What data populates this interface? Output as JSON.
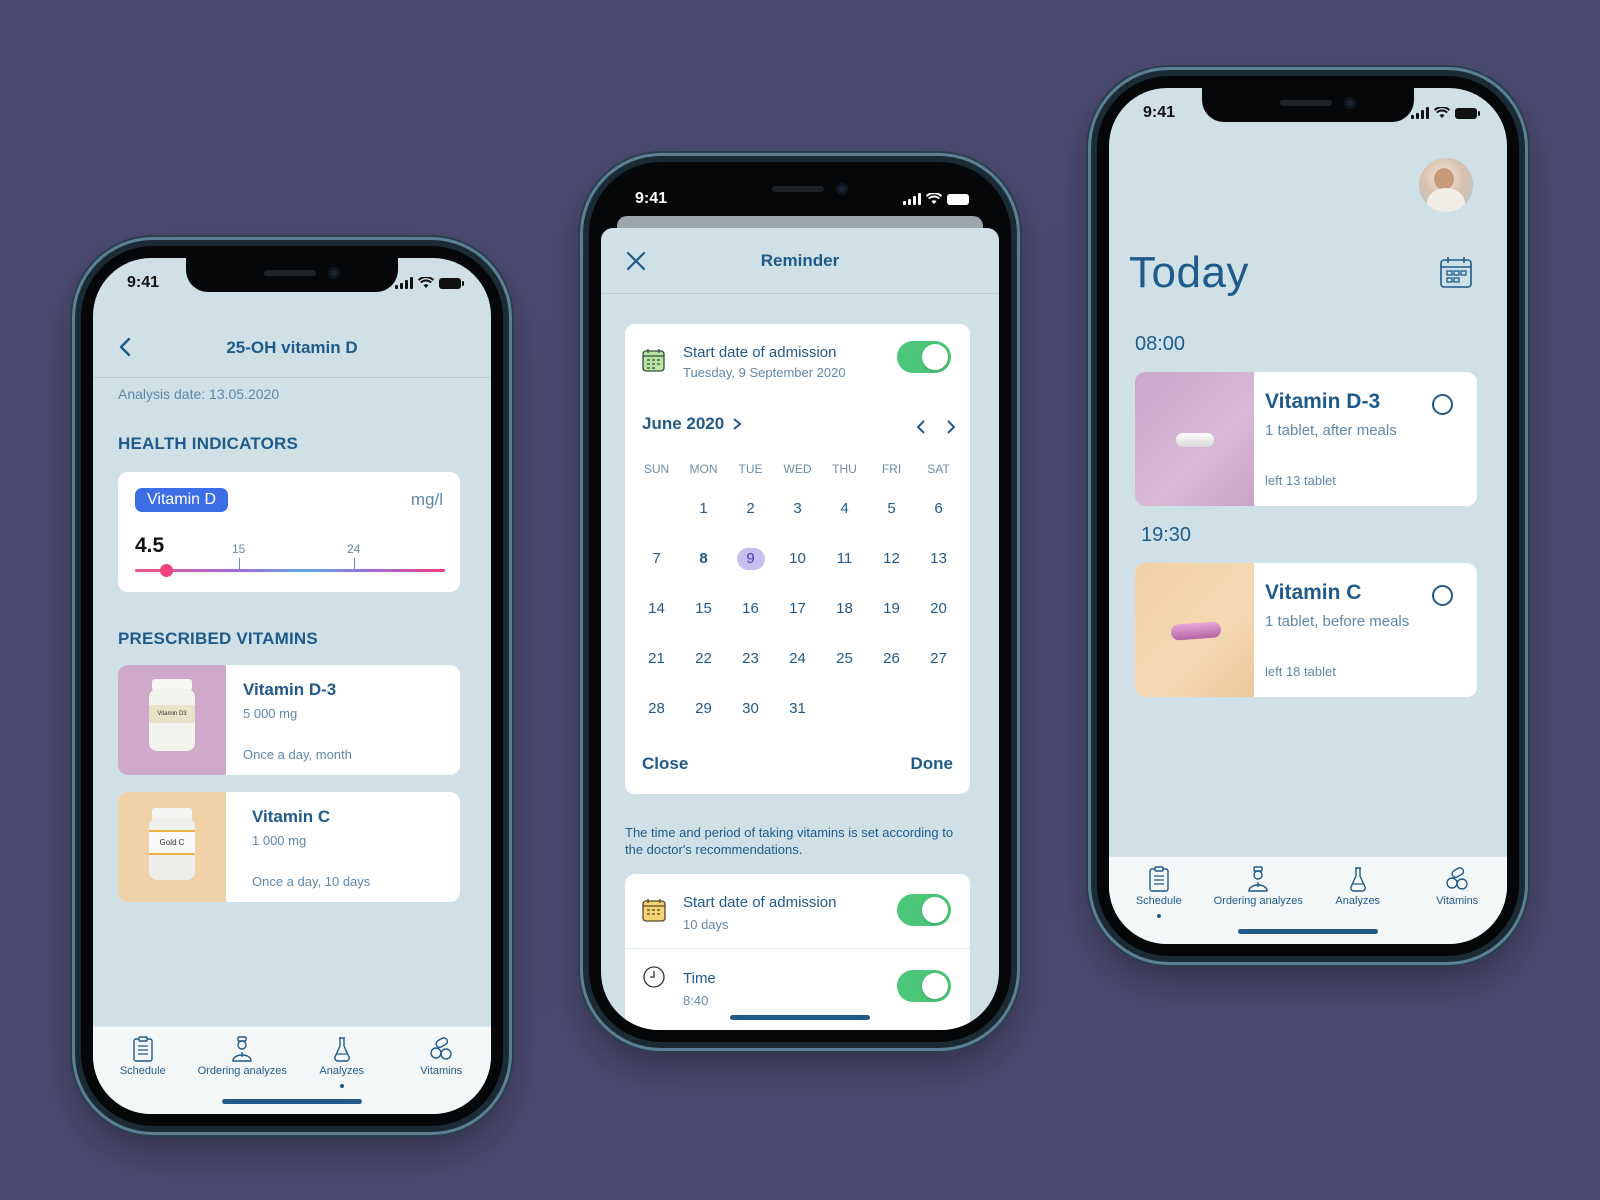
{
  "status": {
    "time": "9:41"
  },
  "tabs": [
    {
      "label": "Schedule",
      "icon": "clipboard-icon"
    },
    {
      "label": "Ordering analyzes",
      "icon": "doctor-icon"
    },
    {
      "label": "Analyzes",
      "icon": "flask-icon"
    },
    {
      "label": "Vitamins",
      "icon": "pills-icon"
    }
  ],
  "phone1": {
    "title": "25-OH vitamin D",
    "analysis_date": "Analysis date: 13.05.2020",
    "health_heading": "HEALTH INDICATORS",
    "indicator": {
      "badge": "Vitamin D",
      "unit": "mg/l",
      "value": "4.5",
      "tick1": "15",
      "tick2": "24",
      "level": 0.1
    },
    "prescribed_heading": "PRESCRIBED VITAMINS",
    "vitamins": [
      {
        "name": "Vitamin D-3",
        "dose": "5 000 mg",
        "schedule": "Once a day, month",
        "bottle_label": "Vitamin D3"
      },
      {
        "name": "Vitamin C",
        "dose": "1 000 mg",
        "schedule": "Once a day, 10 days",
        "bottle_label": "Gold C"
      }
    ],
    "active_tab": 2
  },
  "phone2": {
    "title": "Reminder",
    "start_label": "Start date of admission",
    "start_date": "Tuesday, 9 September 2020",
    "month": "June 2020",
    "weekdays": [
      "SUN",
      "MON",
      "TUE",
      "WED",
      "THU",
      "FRI",
      "SAT"
    ],
    "days": [
      "",
      "1",
      "2",
      "3",
      "4",
      "5",
      "6",
      "7",
      "8",
      "9",
      "10",
      "11",
      "12",
      "13",
      "14",
      "15",
      "16",
      "17",
      "18",
      "19",
      "20",
      "21",
      "22",
      "23",
      "24",
      "25",
      "26",
      "27",
      "28",
      "29",
      "30",
      "31"
    ],
    "today": "8",
    "selected": "9",
    "close_label": "Close",
    "done_label": "Done",
    "note": "The time and period of taking vitamins is set according to the doctor's recommendations.",
    "period_label": "Start date of admission",
    "period_value": "10 days",
    "time_label": "Time",
    "time_value": "8:40"
  },
  "phone3": {
    "title": "Today",
    "slots": [
      {
        "time": "08:00",
        "name": "Vitamin D-3",
        "instruction": "1 tablet, after meals",
        "left": "left 13 tablet"
      },
      {
        "time": "19:30",
        "name": "Vitamin C",
        "instruction": "1 tablet, before meals",
        "left": "left 18 tablet"
      }
    ],
    "active_tab": 0
  },
  "colors": {
    "background": "#4b4a70",
    "screen": "#cfe1e7",
    "primary": "#1f5a8a",
    "badge": "#3d6ee8",
    "toggle_on": "#4cc779",
    "selected_day": "#c8bff0"
  }
}
